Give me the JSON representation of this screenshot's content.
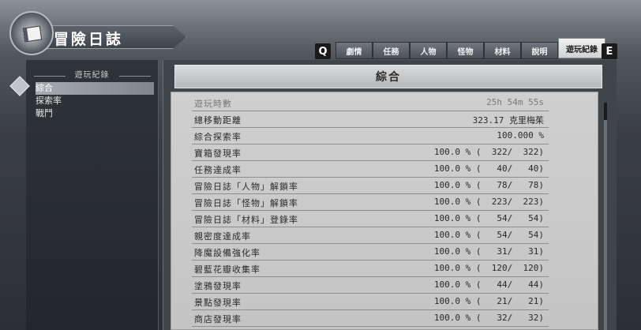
{
  "header": {
    "title": "冒險日誌"
  },
  "keys": {
    "prev": "Q",
    "next": "E"
  },
  "tabs": [
    {
      "label": "劇情"
    },
    {
      "label": "任務"
    },
    {
      "label": "人物"
    },
    {
      "label": "怪物"
    },
    {
      "label": "材料"
    },
    {
      "label": "說明"
    },
    {
      "label": "遊玩紀錄",
      "active": true
    }
  ],
  "sidebar": {
    "heading": "遊玩紀錄",
    "items": [
      {
        "label": "綜合",
        "selected": true
      },
      {
        "label": "探索率"
      },
      {
        "label": "戰鬥"
      }
    ]
  },
  "main": {
    "section_title": "綜合",
    "rows": [
      {
        "label": "遊玩時數",
        "value": "25h 54m 55s"
      },
      {
        "label": "總移動距離",
        "value": "323.17 克里梅茱"
      },
      {
        "label": "綜合探索率",
        "value": "100.000 %"
      },
      {
        "label": "寶箱發現率",
        "value": "100.0 % (  322/  322)"
      },
      {
        "label": "任務達成率",
        "value": "100.0 % (   40/   40)"
      },
      {
        "label": "冒險日誌「人物」解鎖率",
        "value": "100.0 % (   78/   78)"
      },
      {
        "label": "冒險日誌「怪物」解鎖率",
        "value": "100.0 % (  223/  223)"
      },
      {
        "label": "冒險日誌「材料」登錄率",
        "value": "100.0 % (   54/   54)"
      },
      {
        "label": "親密度達成率",
        "value": "100.0 % (   54/   54)"
      },
      {
        "label": "降魔設備強化率",
        "value": "100.0 % (   31/   31)"
      },
      {
        "label": "碧藍花瓣收集率",
        "value": "100.0 % (  120/  120)"
      },
      {
        "label": "塗鴉發現率",
        "value": "100.0 % (   44/   44)"
      },
      {
        "label": "景點發現率",
        "value": "100.0 % (   21/   21)"
      },
      {
        "label": "商店發現率",
        "value": "100.0 % (   32/   32)"
      }
    ]
  },
  "colors": {
    "paper": "#cbcbcb",
    "text_dark": "#2a2a2a",
    "active_tab": "#efefef"
  }
}
